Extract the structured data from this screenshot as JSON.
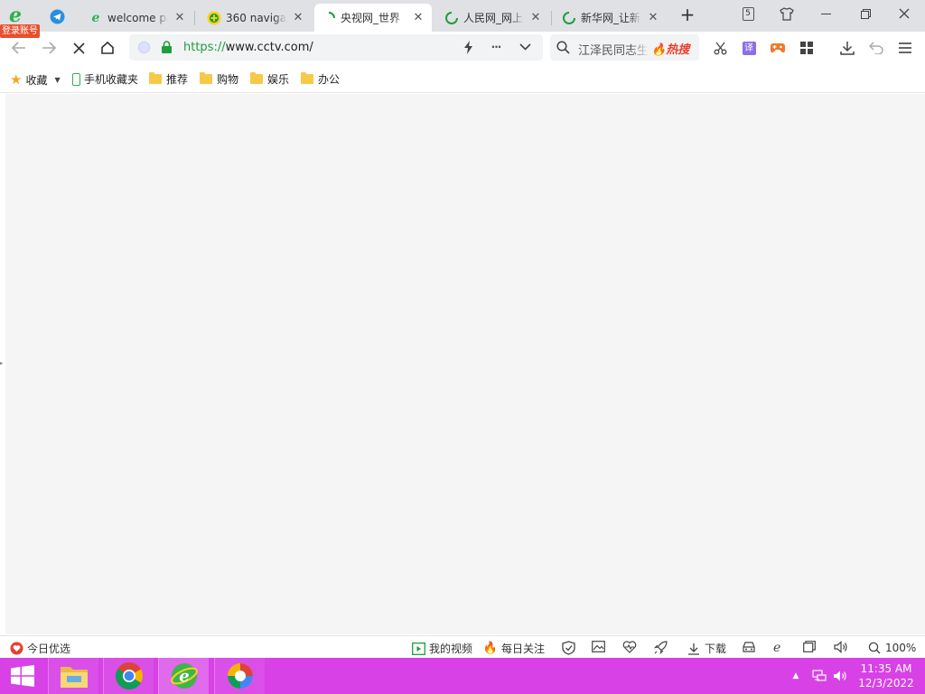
{
  "browser": {
    "login_label": "登录账号",
    "tabs": [
      {
        "title": "welcome pag",
        "close": "✕"
      },
      {
        "title": "360 navigatio",
        "close": "✕"
      },
      {
        "title": "央视网_世界",
        "close": "✕"
      },
      {
        "title": "人民网_网上",
        "close": "✕"
      },
      {
        "title": "新华网_让新",
        "close": "✕"
      }
    ],
    "new_tab": "+",
    "tab_counter": "5"
  },
  "toolbar": {
    "url_scheme": "https://",
    "url_rest": "www.cctv.com/",
    "search_query": "江泽民同志生",
    "search_hot_label": "热搜",
    "menu_dots": "···"
  },
  "bookmarks": {
    "favorites": "收藏",
    "mobile": "手机收藏夹",
    "folders": [
      "推荐",
      "购物",
      "娱乐",
      "办公"
    ]
  },
  "statusbar": {
    "today_pick": "今日优选",
    "my_video": "我的视频",
    "daily_follow": "每日关注",
    "download": "下载",
    "zoom": "100%"
  },
  "taskbar": {
    "time": "11:35 AM",
    "date": "12/3/2022"
  },
  "colors": {
    "taskbar": "#d741e6",
    "accent_green": "#1e9e3c",
    "hot_red": "#e8402d"
  }
}
